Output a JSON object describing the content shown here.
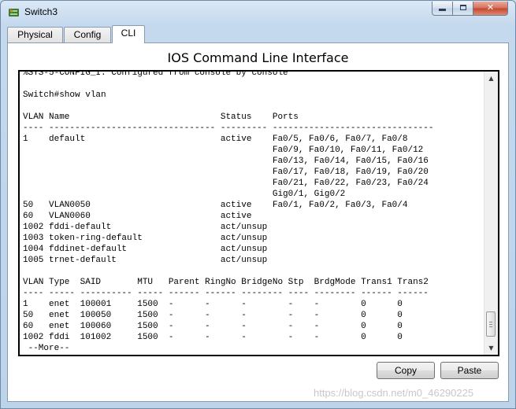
{
  "window": {
    "title": "Switch3",
    "icon": "switch-app-icon"
  },
  "tabs": [
    {
      "label": "Physical",
      "selected": false
    },
    {
      "label": "Config",
      "selected": false
    },
    {
      "label": "CLI",
      "selected": true
    }
  ],
  "cli": {
    "heading": "IOS Command Line Interface",
    "output": "%SYS-5-CONFIG_I: Configured from console by console\n\nSwitch#show vlan\n\nVLAN Name                             Status    Ports\n---- -------------------------------- --------- -------------------------------\n1    default                          active    Fa0/5, Fa0/6, Fa0/7, Fa0/8\n                                                Fa0/9, Fa0/10, Fa0/11, Fa0/12\n                                                Fa0/13, Fa0/14, Fa0/15, Fa0/16\n                                                Fa0/17, Fa0/18, Fa0/19, Fa0/20\n                                                Fa0/21, Fa0/22, Fa0/23, Fa0/24\n                                                Gig0/1, Gig0/2\n50   VLAN0050                         active    Fa0/1, Fa0/2, Fa0/3, Fa0/4\n60   VLAN0060                         active    \n1002 fddi-default                     act/unsup \n1003 token-ring-default               act/unsup \n1004 fddinet-default                  act/unsup \n1005 trnet-default                    act/unsup \n\nVLAN Type  SAID       MTU   Parent RingNo BridgeNo Stp  BrdgMode Trans1 Trans2\n---- ----- ---------- ----- ------ ------ -------- ---- -------- ------ ------\n1    enet  100001     1500  -      -      -        -    -        0      0\n50   enet  100050     1500  -      -      -        -    -        0      0\n60   enet  100060     1500  -      -      -        -    -        0      0\n1002 fddi  101002     1500  -      -      -        -    -        0      0\n --More--"
  },
  "buttons": {
    "copy": "Copy",
    "paste": "Paste"
  },
  "watermark": "https://blog.csdn.net/m0_46290225"
}
